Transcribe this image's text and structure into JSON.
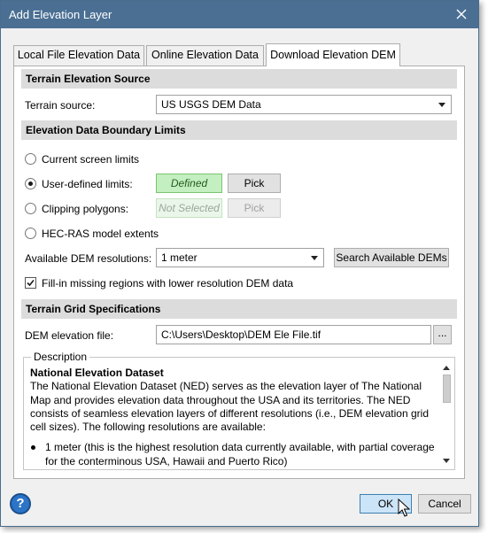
{
  "window": {
    "title": "Add Elevation Layer"
  },
  "tabs": [
    {
      "label": "Local File Elevation Data"
    },
    {
      "label": "Online Elevation Data"
    },
    {
      "label": "Download Elevation DEM",
      "active": true
    }
  ],
  "source_section": {
    "header": "Terrain Elevation Source",
    "terrain_source_label": "Terrain source:",
    "terrain_source_value": "US USGS DEM Data"
  },
  "boundary_section": {
    "header": "Elevation Data Boundary Limits",
    "options": {
      "current_screen": "Current screen limits",
      "user_defined": "User-defined limits:",
      "clipping": "Clipping polygons:",
      "hecras": "HEC-RAS model extents"
    },
    "selected_option": "user_defined",
    "user_defined_status": "Defined",
    "clipping_status": "Not Selected",
    "pick_label": "Pick",
    "resolutions_label": "Available DEM resolutions:",
    "resolution_value": "1 meter",
    "search_button": "Search Available DEMs",
    "fill_in_label": "Fill-in missing regions with lower resolution DEM data",
    "fill_in_checked": true
  },
  "grid_section": {
    "header": "Terrain Grid Specifications",
    "file_label": "DEM elevation file:",
    "file_value": "C:\\Users\\Desktop\\DEM Ele File.tif",
    "browse_label": "..."
  },
  "description": {
    "legend": "Description",
    "heading": "National Elevation Dataset",
    "body": "The National Elevation Dataset (NED) serves as the elevation layer of The National Map and provides elevation data throughout the USA and its territories. The NED consists of seamless elevation layers of different resolutions (i.e., DEM elevation grid cell sizes). The following resolutions are available:",
    "bullets": [
      "1 meter (this is the highest resolution data currently available, with partial coverage for the conterminous USA, Hawaii and Puerto Rico)"
    ]
  },
  "footer": {
    "help": "?",
    "ok": "OK",
    "cancel": "Cancel"
  },
  "colors": {
    "titlebar": "#4a6f93",
    "defined_bg": "#c4efc0",
    "ok_bg": "#cce4f7"
  }
}
